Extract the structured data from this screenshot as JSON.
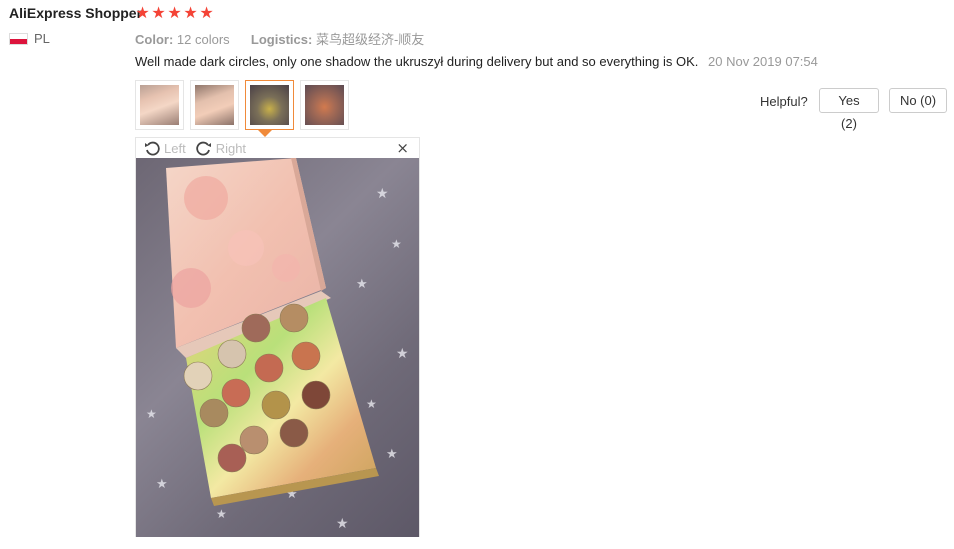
{
  "review": {
    "reviewer": "AliExpress Shopper",
    "rating_stars": 5,
    "country_code": "PL",
    "color_label": "Color:",
    "color_value": "12 colors",
    "logistics_label": "Logistics:",
    "logistics_value": "菜鸟超级经济-顺友",
    "text": "Well made dark circles, only one shadow the ukruszył during delivery but and so everything is OK.",
    "date": "20 Nov 2019 07:54"
  },
  "helpful": {
    "label": "Helpful?",
    "yes": "Yes (2)",
    "no": "No (0)"
  },
  "viewer": {
    "rotate_left": "Left",
    "rotate_right": "Right",
    "close": "×",
    "active_thumb_index": 2
  },
  "colors": {
    "star": "#f44336",
    "active_border": "#f08a3a",
    "flag_red": "#dc143c"
  },
  "icons": {
    "star": "star-icon",
    "rotate_left": "rotate-left-icon",
    "rotate_right": "rotate-right-icon",
    "close": "close-icon",
    "flag": "poland-flag-icon"
  }
}
